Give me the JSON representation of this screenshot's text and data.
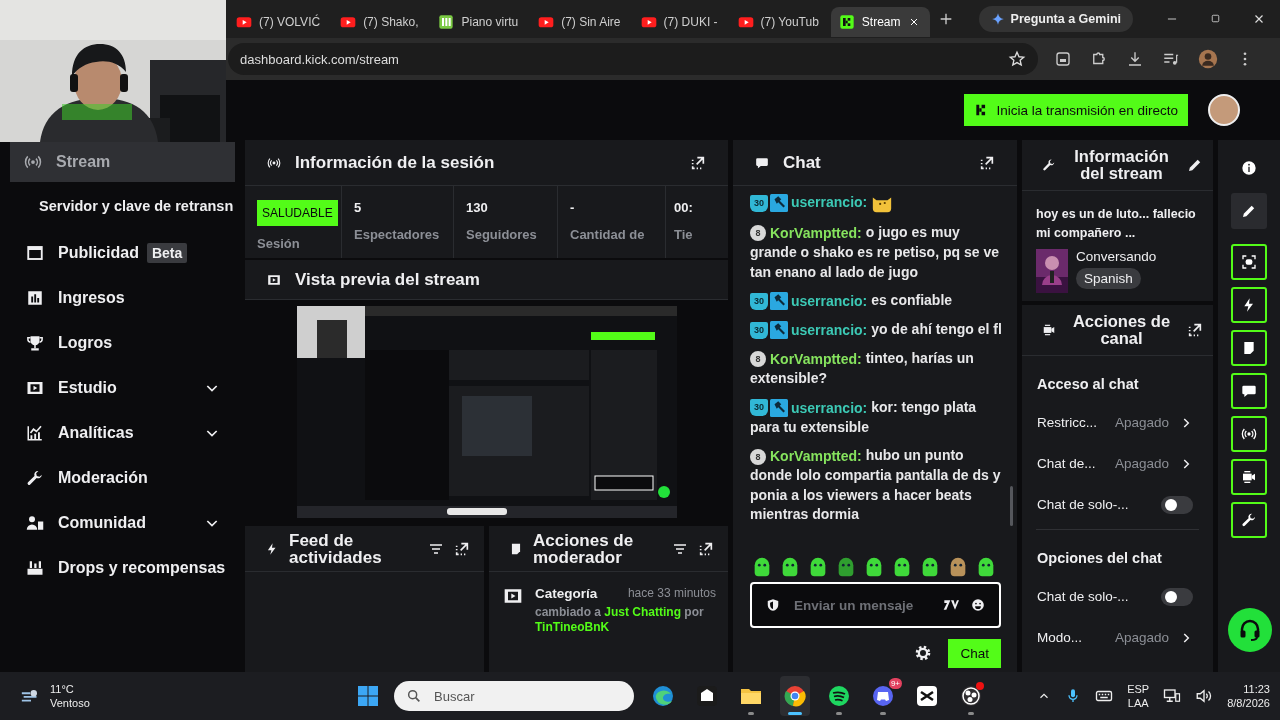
{
  "browser": {
    "tabs": [
      {
        "title": "(7) VOLVIĆ",
        "kind": "youtube",
        "selected": false
      },
      {
        "title": "(7) Shako,",
        "kind": "youtube",
        "selected": false
      },
      {
        "title": "Piano virtu",
        "kind": "piano",
        "selected": false
      },
      {
        "title": "(7) Sin Aire",
        "kind": "youtube",
        "selected": false
      },
      {
        "title": "(7) DUKI -",
        "kind": "youtube",
        "selected": false
      },
      {
        "title": "(7) YouTub",
        "kind": "youtube",
        "selected": false
      },
      {
        "title": "Stream",
        "kind": "kick",
        "selected": true
      }
    ],
    "gemini_button": "Pregunta a Gemini",
    "url": "dashboard.kick.com/stream"
  },
  "header": {
    "go_live_button": "Inicia la transmisión en directo"
  },
  "sidebar": {
    "items": [
      {
        "label": "Stream",
        "kind": "main",
        "selected": true,
        "has_children": false
      },
      {
        "label": "Servidor y clave de retransn",
        "kind": "sub",
        "selected": false,
        "has_children": false
      },
      {
        "label": "Publicidad",
        "badge": "Beta",
        "kind": "main",
        "selected": false,
        "has_children": false
      },
      {
        "label": "Ingresos",
        "kind": "main",
        "selected": false,
        "has_children": false
      },
      {
        "label": "Logros",
        "kind": "main",
        "selected": false,
        "has_children": false
      },
      {
        "label": "Estudio",
        "kind": "main",
        "selected": false,
        "has_children": true
      },
      {
        "label": "Analíticas",
        "kind": "main",
        "selected": false,
        "has_children": true
      },
      {
        "label": "Moderación",
        "kind": "main",
        "selected": false,
        "has_children": false
      },
      {
        "label": "Comunidad",
        "kind": "main",
        "selected": false,
        "has_children": true
      },
      {
        "label": "Drops y recompensas",
        "kind": "main",
        "selected": false,
        "has_children": false
      }
    ]
  },
  "session": {
    "title": "Información de la sesión",
    "status_badge": "SALUDABLE",
    "status_label": "Sesión",
    "stats": [
      {
        "value": "5",
        "label": "Espectadores"
      },
      {
        "value": "130",
        "label": "Seguidores"
      },
      {
        "value": "-",
        "label": "Cantidad de"
      },
      {
        "value": "00:",
        "label": "Tie"
      }
    ]
  },
  "preview": {
    "title": "Vista previa del stream"
  },
  "activity_feed": {
    "title": "Feed de actividades"
  },
  "mod_actions": {
    "title": "Acciones de moderador",
    "events": [
      {
        "title": "Categoría",
        "time": "hace 33 minutos",
        "prefix": "cambiado a",
        "category": "Just Chatting",
        "joiner": "por",
        "user": "TinTineoBnK"
      }
    ]
  },
  "chat": {
    "title": "Chat",
    "messages": [
      {
        "kind": "emote",
        "badges": [
          {
            "kind": "sub",
            "label": "30"
          },
          {
            "kind": "mod"
          }
        ],
        "user": "userrancio:",
        "color": "#3cc9b5"
      },
      {
        "kind": "text",
        "badges": [
          {
            "kind": "gift",
            "label": "8"
          }
        ],
        "user": "KorVamptted:",
        "color": "#86e35e",
        "text": "o jugo es muy grande o shako es re petiso, pq se ve tan enano al lado de jugo"
      },
      {
        "kind": "text",
        "badges": [
          {
            "kind": "sub",
            "label": "30"
          },
          {
            "kind": "mod"
          }
        ],
        "user": "userrancio:",
        "color": "#3cc9b5",
        "text": "es confiable"
      },
      {
        "kind": "text",
        "badges": [
          {
            "kind": "sub",
            "label": "30"
          },
          {
            "kind": "mod"
          }
        ],
        "user": "userrancio:",
        "color": "#3cc9b5",
        "text": "yo de ahí tengo el fl"
      },
      {
        "kind": "text",
        "badges": [
          {
            "kind": "gift",
            "label": "8"
          }
        ],
        "user": "KorVamptted:",
        "color": "#86e35e",
        "text": "tinteo, harías un extensible?"
      },
      {
        "kind": "text",
        "badges": [
          {
            "kind": "sub",
            "label": "30"
          },
          {
            "kind": "mod"
          }
        ],
        "user": "userrancio:",
        "color": "#3cc9b5",
        "text": "kor: tengo plata para tu extensible"
      },
      {
        "kind": "text",
        "badges": [
          {
            "kind": "gift",
            "label": "8"
          }
        ],
        "user": "KorVamptted:",
        "color": "#86e35e",
        "text": "hubo un punto donde lolo compartia pantalla de ds y ponia a los viewers a hacer beats mientras dormia"
      }
    ],
    "input_placeholder": "Enviar un mensaje",
    "send_button": "Chat"
  },
  "stream_info": {
    "title": "Información del stream",
    "stream_title": "hoy es un de luto... fallecio mi compañero ...",
    "category": "Conversando",
    "tag": "Spanish"
  },
  "channel_actions": {
    "title": "Acciones de canal",
    "sections": [
      {
        "heading": "Acceso al chat",
        "rows": [
          {
            "kind": "select",
            "label": "Restricc...",
            "value": "Apagado"
          },
          {
            "kind": "select",
            "label": "Chat de...",
            "value": "Apagado"
          },
          {
            "kind": "toggle",
            "label": "Chat de solo-...",
            "on": false
          }
        ]
      },
      {
        "heading": "Opciones del chat",
        "rows": [
          {
            "kind": "toggle",
            "label": "Chat de solo-...",
            "on": false
          },
          {
            "kind": "select",
            "label": "Modo...",
            "value": "Apagado"
          }
        ]
      }
    ]
  },
  "rail": [
    {
      "pinned": false,
      "selected": false
    },
    {
      "pinned": false,
      "selected": true
    },
    {
      "pinned": true,
      "selected": false
    },
    {
      "pinned": true,
      "selected": false
    },
    {
      "pinned": true,
      "selected": false
    },
    {
      "pinned": true,
      "selected": false
    },
    {
      "pinned": true,
      "selected": false
    },
    {
      "pinned": true,
      "selected": false
    },
    {
      "pinned": true,
      "selected": false
    }
  ],
  "taskbar": {
    "temperature": "11°C",
    "condition": "Ventoso",
    "search_placeholder": "Buscar",
    "apps": [
      {
        "running": false,
        "active": false,
        "notification": false
      },
      {
        "running": false,
        "active": false,
        "notification": false
      },
      {
        "running": true,
        "active": false,
        "notification": false
      },
      {
        "running": true,
        "active": true,
        "notification": false
      },
      {
        "running": true,
        "active": false,
        "notification": false
      },
      {
        "running": true,
        "active": false,
        "badge": "9+",
        "notification": false
      },
      {
        "running": false,
        "active": false,
        "notification": false
      },
      {
        "running": true,
        "active": false,
        "notification": true
      }
    ],
    "language": "ESP",
    "layout": "LAA",
    "time": "11:23",
    "date": "8/8/2026"
  }
}
